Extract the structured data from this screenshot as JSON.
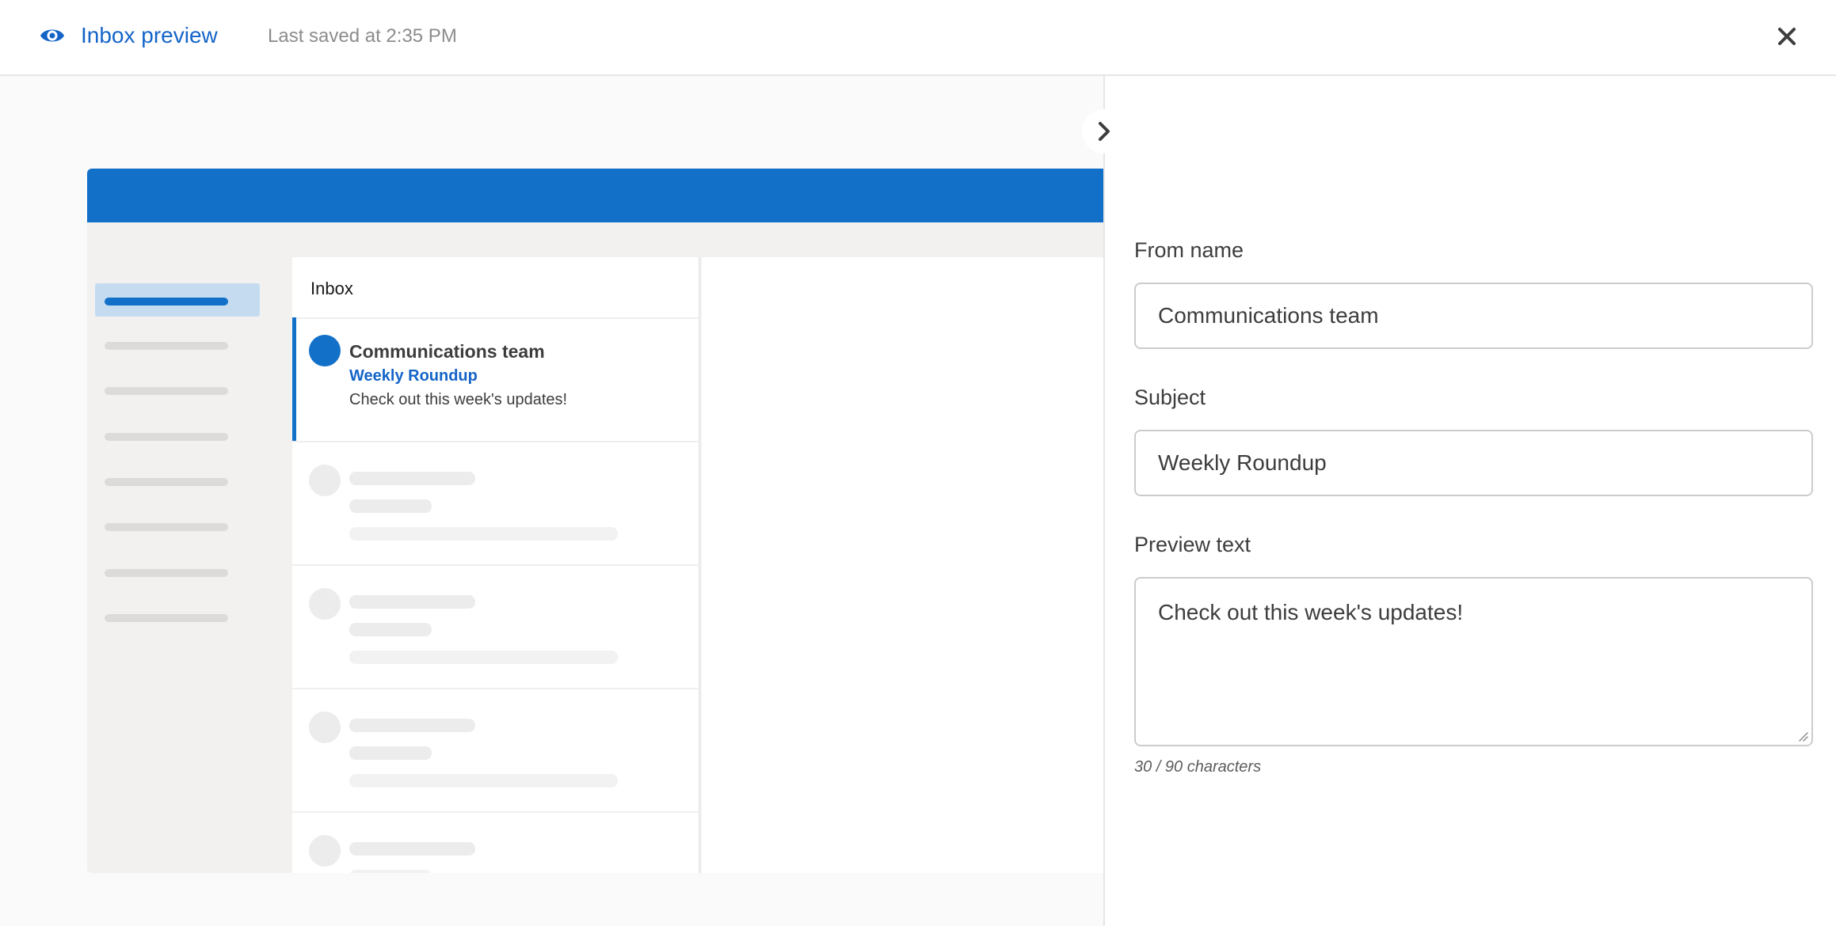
{
  "header": {
    "title": "Inbox preview",
    "saved_status": "Last saved at 2:35 PM"
  },
  "preview": {
    "inbox_label": "Inbox",
    "selected_message": {
      "sender": "Communications team",
      "subject": "Weekly Roundup",
      "snippet": "Check out this week's updates!"
    }
  },
  "form": {
    "from_name": {
      "label": "From name",
      "value": "Communications team"
    },
    "subject": {
      "label": "Subject",
      "value": "Weekly Roundup"
    },
    "preview_text": {
      "label": "Preview text",
      "value": "Check out this week's updates!"
    },
    "char_count": "30 / 90 characters"
  },
  "icons": {
    "header": "eye-icon",
    "close": "close-icon",
    "toggle": "chevron-right-icon"
  },
  "colors": {
    "accent": "#1464c8",
    "preview_bar": "#1370c9",
    "selected_folder": "#c4dbf0"
  }
}
